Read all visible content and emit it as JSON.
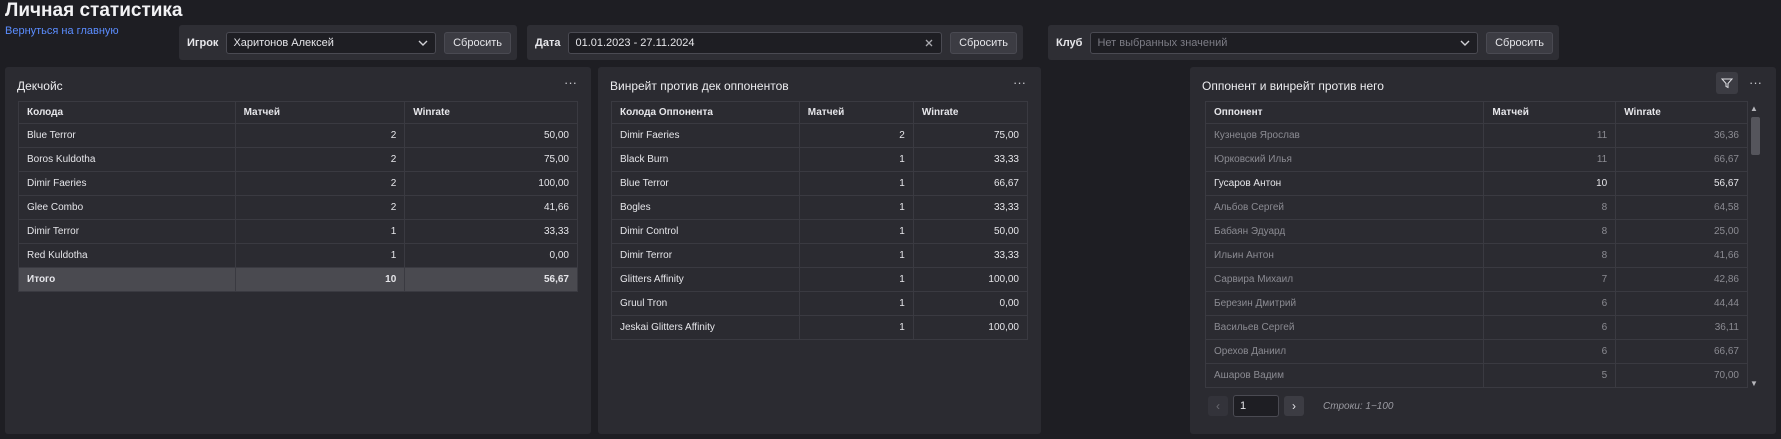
{
  "page": {
    "title": "Личная статистика",
    "back_link": "Вернуться на главную"
  },
  "filters": {
    "player": {
      "label": "Игрок",
      "value": "Харитонов Алексей",
      "reset": "Сбросить"
    },
    "date": {
      "label": "Дата",
      "value": "01.01.2023 - 27.11.2024",
      "reset": "Сбросить"
    },
    "club": {
      "label": "Клуб",
      "placeholder": "Нет выбранных значений",
      "reset": "Сбросить"
    }
  },
  "deck_panel": {
    "title": "Декчойс",
    "headers": [
      "Колода",
      "Матчей",
      "Winrate"
    ],
    "rows": [
      [
        "Blue Terror",
        "2",
        "50,00"
      ],
      [
        "Boros Kuldotha",
        "2",
        "75,00"
      ],
      [
        "Dimir Faeries",
        "2",
        "100,00"
      ],
      [
        "Glee Combo",
        "2",
        "41,66"
      ],
      [
        "Dimir Terror",
        "1",
        "33,33"
      ],
      [
        "Red Kuldotha",
        "1",
        "0,00"
      ]
    ],
    "total": [
      "Итого",
      "10",
      "56,67"
    ]
  },
  "opp_deck_panel": {
    "title": "Винрейт против дек оппонентов",
    "headers": [
      "Колода Оппонента",
      "Матчей",
      "Winrate"
    ],
    "rows": [
      [
        "Dimir Faeries",
        "2",
        "75,00"
      ],
      [
        "Black Burn",
        "1",
        "33,33"
      ],
      [
        "Blue Terror",
        "1",
        "66,67"
      ],
      [
        "Bogles",
        "1",
        "33,33"
      ],
      [
        "Dimir Control",
        "1",
        "50,00"
      ],
      [
        "Dimir Terror",
        "1",
        "33,33"
      ],
      [
        "Glitters Affinity",
        "1",
        "100,00"
      ],
      [
        "Gruul Tron",
        "1",
        "0,00"
      ],
      [
        "Jeskai Glitters Affinity",
        "1",
        "100,00"
      ]
    ]
  },
  "opponent_panel": {
    "title": "Оппонент и винрейт против него",
    "headers": [
      "Оппонент",
      "Матчей",
      "Winrate"
    ],
    "rows": [
      [
        "Кузнецов Ярослав",
        "11",
        "36,36"
      ],
      [
        "Юрковский Илья",
        "11",
        "66,67"
      ],
      [
        "Гусаров Антон",
        "10",
        "56,67"
      ],
      [
        "Альбов Сергей",
        "8",
        "64,58"
      ],
      [
        "Бабаян Эдуард",
        "8",
        "25,00"
      ],
      [
        "Ильин Антон",
        "8",
        "41,66"
      ],
      [
        "Сарвира Михаил",
        "7",
        "42,86"
      ],
      [
        "Березин Дмитрий",
        "6",
        "44,44"
      ],
      [
        "Васильев Сергей",
        "6",
        "36,11"
      ],
      [
        "Орехов Даниил",
        "6",
        "66,67"
      ],
      [
        "Ашаров Вадим",
        "5",
        "70,00"
      ]
    ],
    "highlighted_row": 2,
    "pager": {
      "page": "1",
      "rows_info": "Строки: 1−100"
    }
  },
  "colors": {
    "background": "#1e1e23",
    "panel": "#2b2b31",
    "link": "#5b8dff",
    "total_row": "#4a4a50"
  }
}
